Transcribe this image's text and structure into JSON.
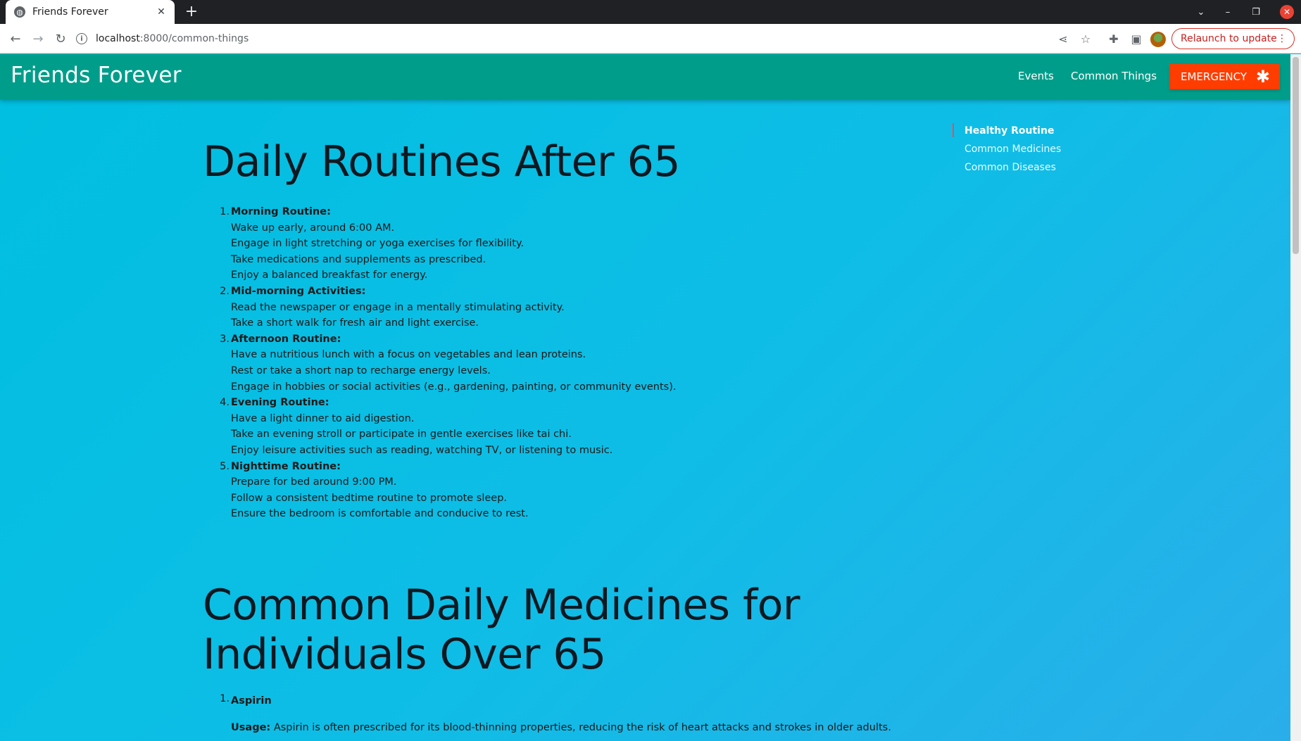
{
  "browser": {
    "tab_title": "Friends Forever",
    "url_host": "localhost",
    "url_rest": ":8000/common-things",
    "relaunch_label": "Relaunch to update"
  },
  "navbar": {
    "brand": "Friends Forever",
    "links": [
      "Events",
      "Common Things"
    ],
    "emergency_label": "EMERGENCY",
    "accent_color": "#009e8a",
    "emergency_color": "#ff3d00"
  },
  "toc": {
    "items": [
      "Healthy Routine",
      "Common Medicines",
      "Common Diseases"
    ],
    "active_index": 0
  },
  "routines": {
    "title": "Daily Routines After 65",
    "items": [
      {
        "number": "1.",
        "heading": "Morning Routine:",
        "lines": [
          "Wake up early, around 6:00 AM.",
          "Engage in light stretching or yoga exercises for flexibility.",
          "Take medications and supplements as prescribed.",
          "Enjoy a balanced breakfast for energy."
        ]
      },
      {
        "number": "2.",
        "heading": "Mid-morning Activities:",
        "lines": [
          "Read the newspaper or engage in a mentally stimulating activity.",
          "Take a short walk for fresh air and light exercise."
        ]
      },
      {
        "number": "3.",
        "heading": "Afternoon Routine:",
        "lines": [
          "Have a nutritious lunch with a focus on vegetables and lean proteins.",
          "Rest or take a short nap to recharge energy levels.",
          "Engage in hobbies or social activities (e.g., gardening, painting, or community events)."
        ]
      },
      {
        "number": "4.",
        "heading": "Evening Routine:",
        "lines": [
          "Have a light dinner to aid digestion.",
          "Take an evening stroll or participate in gentle exercises like tai chi.",
          "Enjoy leisure activities such as reading, watching TV, or listening to music."
        ]
      },
      {
        "number": "5.",
        "heading": "Nighttime Routine:",
        "lines": [
          "Prepare for bed around 9:00 PM.",
          "Follow a consistent bedtime routine to promote sleep.",
          "Ensure the bedroom is comfortable and conducive to rest."
        ]
      }
    ]
  },
  "medicines": {
    "title": "Common Daily Medicines for Individuals Over 65",
    "items": [
      {
        "number": "1.",
        "name": "Aspirin",
        "usage_label": "Usage:",
        "usage_text": "Aspirin is often prescribed for its blood-thinning properties, reducing the risk of heart attacks and strokes in older adults."
      }
    ]
  }
}
